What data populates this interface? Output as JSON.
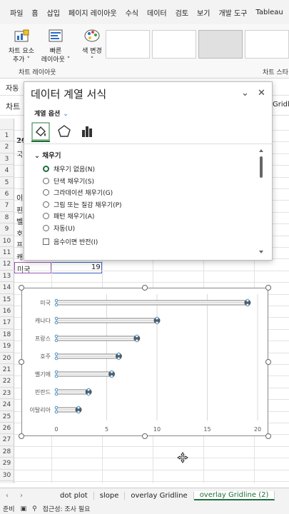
{
  "menu": [
    "파일",
    "홈",
    "삽입",
    "페이지 레이아웃",
    "수식",
    "데이터",
    "검토",
    "보기",
    "개발 도구",
    "Tableau"
  ],
  "ribbon": {
    "add_element": "차트 요소\n추가 ˅",
    "quick_layout": "빠른\n레이아웃 ˅",
    "change_color": "색 변경\n˅",
    "group_layout": "차트 레이아웃",
    "group_style": "차트 스타"
  },
  "row2_text": "자동 ",
  "row3": {
    "namebox": "차트",
    "right": "Gridline"
  },
  "cells": {
    "a2_prefix": "20",
    "a3_prefix": "국",
    "a4": "이",
    "a5": "핀",
    "a6": "벨",
    "a7": "호",
    "a8": "프",
    "a9": "캐",
    "a10": "미국",
    "b10": "19"
  },
  "pane": {
    "title": "데이터 계열 서식",
    "subtitle": "계열 옵션",
    "section": "채우기",
    "options": [
      {
        "label": "채우기 없음(N)",
        "selected": true
      },
      {
        "label": "단색 채우기(S)",
        "selected": false
      },
      {
        "label": "그라데이션 채우기(G)",
        "selected": false
      },
      {
        "label": "그림 또는 질감 채우기(P)",
        "selected": false
      },
      {
        "label": "패턴 채우기(A)",
        "selected": false
      },
      {
        "label": "자동(U)",
        "selected": false
      }
    ],
    "invert": "음수이면 반전(I)"
  },
  "chart_data": {
    "type": "bar",
    "categories": [
      "미국",
      "캐나다",
      "프랑스",
      "호주",
      "벨기에",
      "핀란드",
      "이탈리아"
    ],
    "values": [
      19,
      10,
      8,
      6.2,
      5.5,
      3.2,
      2.2
    ],
    "xlim": [
      0,
      20
    ],
    "xticks": [
      "0",
      "5",
      "10",
      "15",
      "20"
    ],
    "grid": true,
    "colors": {
      "bar": "#7f7f7f",
      "marker": "#595959",
      "endpoint": "#4a90c8",
      "gridline": "#d9d9d9"
    }
  },
  "sheet_tabs": [
    "dot plot",
    "slope",
    "overlay Gridline",
    "overlay Gridline (2)"
  ],
  "status": {
    "ready": "준비",
    "access": "접근성: 조사 필요"
  }
}
